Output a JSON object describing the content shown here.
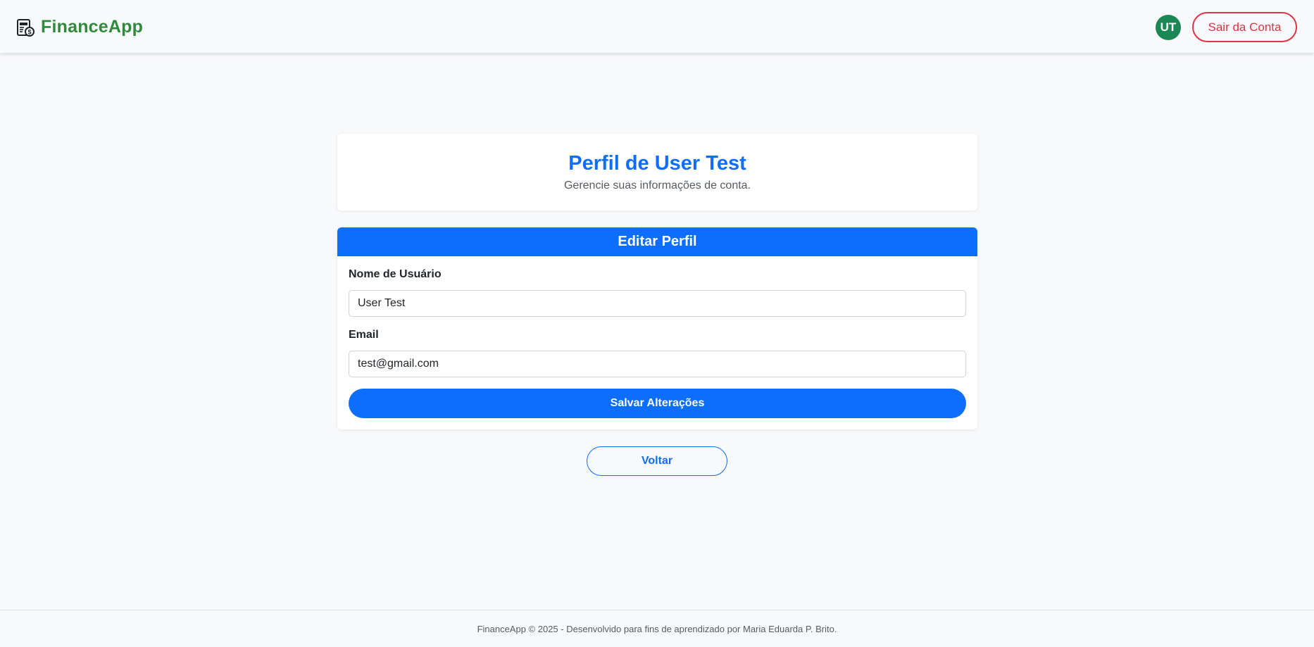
{
  "navbar": {
    "brand": "FinanceApp",
    "brand_icon": "finance-document-icon",
    "brand_color": "#2f8a3b",
    "avatar_initials": "UT",
    "avatar_color": "#1a8754",
    "logout_label": "Sair da Conta",
    "logout_color": "#dc3545"
  },
  "header_card": {
    "title": "Perfil de User Test",
    "subtitle": "Gerencie suas informações de conta."
  },
  "edit_card": {
    "header": "Editar Perfil",
    "username_label": "Nome de Usuário",
    "username_value": "User Test",
    "email_label": "Email",
    "email_value": "test@gmail.com",
    "save_label": "Salvar Alterações",
    "accent_color": "#0d6efd"
  },
  "back_label": "Voltar",
  "footer": {
    "text": "FinanceApp © 2025 - Desenvolvido para fins de aprendizado por Maria Eduarda P. Brito."
  }
}
